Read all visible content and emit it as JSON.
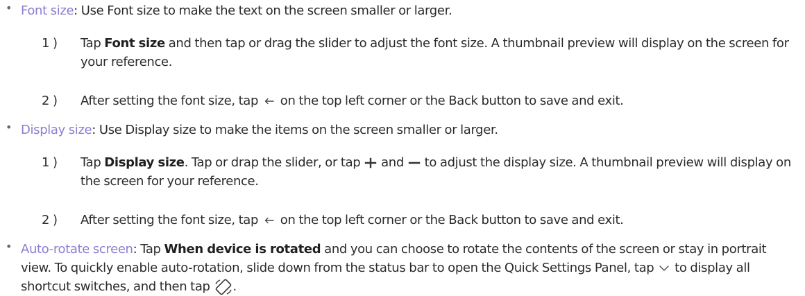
{
  "sections": {
    "font_size": {
      "term": "Font size",
      "desc": ": Use Font size to make the text on the screen smaller or larger.",
      "step1": {
        "num": "1 )",
        "pre": "Tap ",
        "bold": "Font size",
        "post": " and then tap or drag the slider to adjust the font size. A thumbnail preview will display on the screen for your reference."
      },
      "step2": {
        "num": "2 )",
        "pre": "After setting the font size, tap ",
        "post": " on the top left corner or the Back button to save and exit."
      }
    },
    "display_size": {
      "term": "Display size",
      "desc": ": Use Display size to make the items on the screen smaller or larger.",
      "step1": {
        "num": "1 )",
        "pre": "Tap ",
        "bold": "Display size",
        "mid1": ". Tap or drap the slider, or tap ",
        "mid2": " and ",
        "post": " to adjust the display size. A thumbnail preview will display on the screen for your reference."
      },
      "step2": {
        "num": "2 )",
        "pre": "After setting the font size, tap ",
        "post": " on the top left corner or the Back button to save and exit."
      }
    },
    "auto_rotate": {
      "term": "Auto-rotate screen",
      "pre": ": Tap ",
      "bold": "When device is rotated",
      "mid": " and you can choose to rotate the contents of the screen or stay in portrait view. To quickly enable auto-rotation, slide down from the status bar to open the Quick Settings Panel, tap ",
      "mid2": " to display all shortcut switches, and then tap ",
      "post": "."
    }
  },
  "icons": {
    "bullet": "•",
    "back_arrow": "back-arrow-icon",
    "plus": "plus-icon",
    "minus": "minus-icon",
    "chevron_down": "chevron-down-icon",
    "auto_rotate": "auto-rotate-icon"
  }
}
